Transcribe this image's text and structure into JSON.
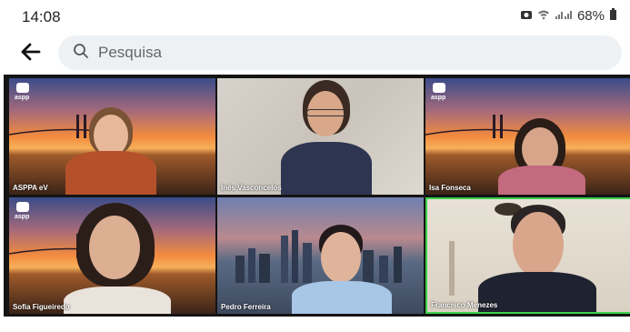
{
  "status": {
    "time": "14:08",
    "battery": "68%"
  },
  "search": {
    "placeholder": "Pesquisa"
  },
  "participants": [
    {
      "name": "ASPPA eV",
      "logo": "aspp"
    },
    {
      "name": "Inês Vasconcelos",
      "logo": ""
    },
    {
      "name": "Isa Fonseca",
      "logo": "aspp"
    },
    {
      "name": "Sofia Figueiredo",
      "logo": "aspp"
    },
    {
      "name": "Pedro Ferreira",
      "logo": ""
    },
    {
      "name": "Francisco Menezes",
      "logo": ""
    }
  ],
  "colors": {
    "active_speaker": "#3cd14b",
    "grid_bg": "#141414"
  }
}
